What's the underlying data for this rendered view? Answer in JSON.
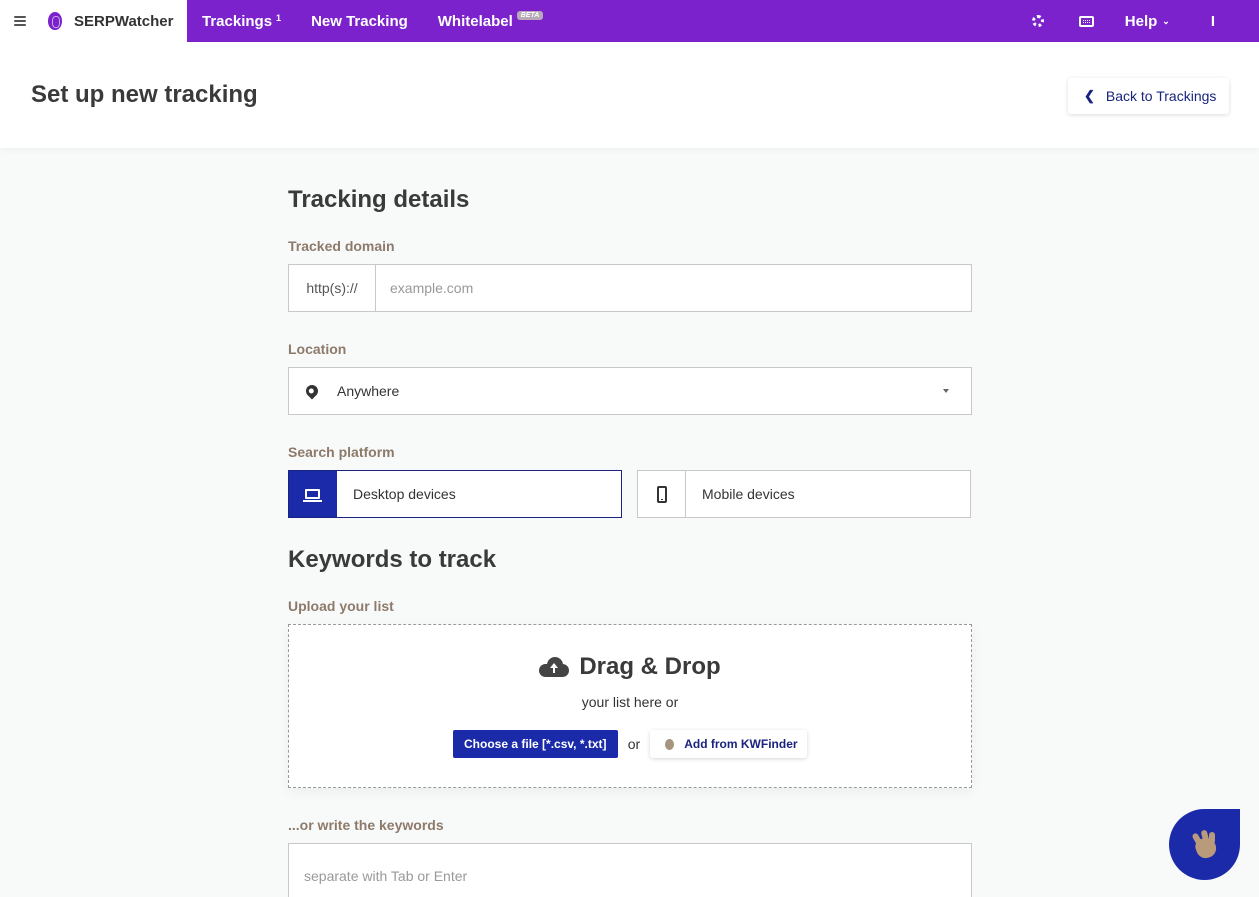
{
  "nav": {
    "brand": "SERPWatcher",
    "trackings_label": "Trackings",
    "trackings_count": "1",
    "new_tracking_label": "New Tracking",
    "whitelabel_label": "Whitelabel",
    "beta_badge": "BETA",
    "help_label": "Help",
    "user_initial": "I"
  },
  "header": {
    "title": "Set up new tracking",
    "back_label": "Back to Trackings"
  },
  "tracking_details": {
    "title": "Tracking details",
    "domain_label": "Tracked domain",
    "domain_prefix": "http(s)://",
    "domain_placeholder": "example.com",
    "location_label": "Location",
    "location_value": "Anywhere",
    "platform_label": "Search platform",
    "platform_desktop": "Desktop devices",
    "platform_mobile": "Mobile devices",
    "selected_platform": "Desktop devices"
  },
  "keywords": {
    "title": "Keywords to track",
    "upload_label": "Upload your list",
    "drop_title": "Drag & Drop",
    "drop_subtitle": "your list here or",
    "choose_file_label": "Choose a file [*.csv, *.txt]",
    "or_text": "or",
    "kwfinder_label": "Add from KWFinder",
    "write_label": "...or write the keywords",
    "write_placeholder": "separate with Tab or Enter"
  },
  "colors": {
    "brand_purple": "#7b22cc",
    "accent_blue": "#1a2aa8",
    "link_navy": "#1a237e"
  },
  "icons": [
    "menu-icon",
    "serpwatcher-logo",
    "gear-icon",
    "keyboard-icon",
    "chevron-down-icon",
    "chevron-left-icon",
    "location-pin-icon",
    "caret-down-icon",
    "laptop-icon",
    "phone-icon",
    "cloud-upload-icon",
    "kwfinder-icon",
    "waving-hand-icon"
  ]
}
